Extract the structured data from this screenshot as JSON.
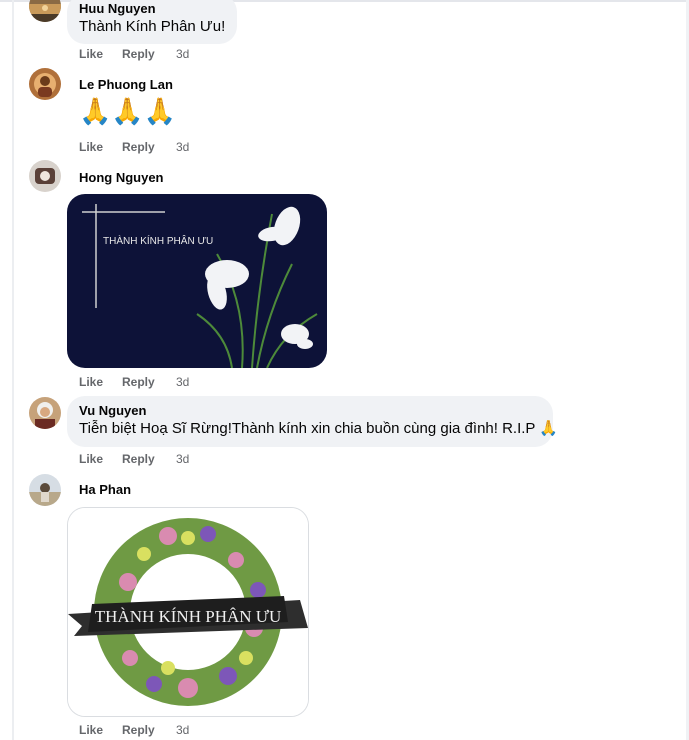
{
  "comments": [
    {
      "author": "Huu Nguyen",
      "text": "Thành Kính Phân Ưu!",
      "like": "Like",
      "reply": "Reply",
      "time": "3d"
    },
    {
      "author": "Le Phuong Lan",
      "text": "🙏🙏🙏",
      "like": "Like",
      "reply": "Reply",
      "time": "3d"
    },
    {
      "author": "Hong Nguyen",
      "image_caption": "THÀNH KÍNH PHÂN ƯU",
      "like": "Like",
      "reply": "Reply",
      "time": "3d"
    },
    {
      "author": "Vu Nguyen",
      "text": "Tiễn biệt Hoạ Sĩ Rừng!Thành kính xin chia buồn cùng gia đình! R.I.P",
      "emoji": "🙏",
      "like": "Like",
      "reply": "Reply",
      "time": "3d"
    },
    {
      "author": "Ha Phan",
      "image_caption": "THÀNH KÍNH PHÂN ƯU",
      "like": "Like",
      "reply": "Reply",
      "time": "3d"
    }
  ],
  "colors": {
    "bubble": "#f0f2f5",
    "meta": "#65676b",
    "text": "#050505"
  }
}
